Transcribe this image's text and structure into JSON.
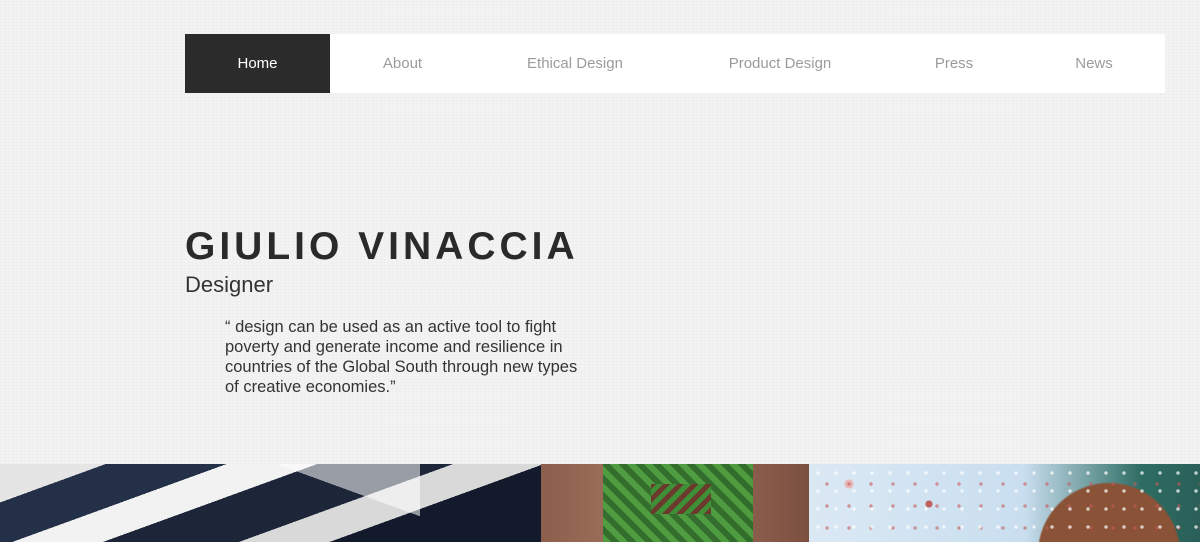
{
  "nav": {
    "items": [
      {
        "label": "Home",
        "active": true
      },
      {
        "label": "About",
        "active": false
      },
      {
        "label": "Ethical Design",
        "active": false
      },
      {
        "label": "Product Design",
        "active": false
      },
      {
        "label": "Press",
        "active": false
      },
      {
        "label": "News",
        "active": false
      }
    ]
  },
  "hero": {
    "name": "GIULIO VINACCIA",
    "role": "Designer",
    "quote": "“ design can be used as an active tool to fight poverty and generate income and resilience in countries of the Global South through new types of creative economies.”"
  },
  "colors": {
    "background": "#f3f3f3",
    "nav_background": "#ffffff",
    "nav_active": "#2b2b2b",
    "nav_text": "#9b9b9b",
    "heading_text": "#2a2a2a"
  }
}
